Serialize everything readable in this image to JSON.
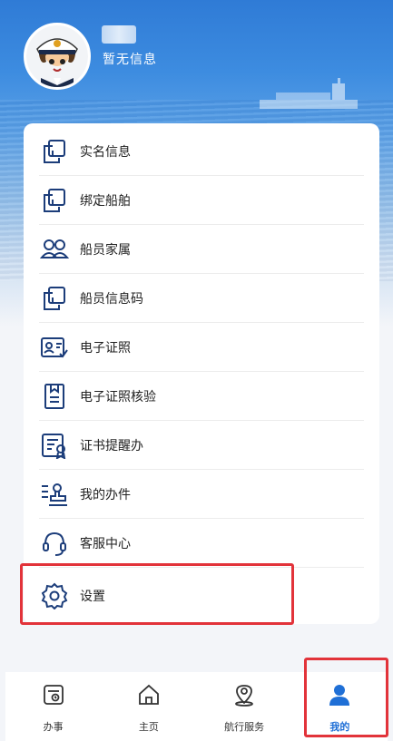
{
  "profile": {
    "info_text": "暂无信息"
  },
  "menu": {
    "items": [
      {
        "label": "实名信息",
        "icon": "id-card-icon"
      },
      {
        "label": "绑定船舶",
        "icon": "bind-ship-icon"
      },
      {
        "label": "船员家属",
        "icon": "family-icon"
      },
      {
        "label": "船员信息码",
        "icon": "qr-info-icon"
      },
      {
        "label": "电子证照",
        "icon": "certificate-icon"
      },
      {
        "label": "电子证照核验",
        "icon": "verify-icon"
      },
      {
        "label": "证书提醒办",
        "icon": "reminder-icon"
      },
      {
        "label": "我的办件",
        "icon": "my-cases-icon"
      },
      {
        "label": "客服中心",
        "icon": "headset-icon"
      },
      {
        "label": "设置",
        "icon": "gear-icon"
      }
    ]
  },
  "tabbar": {
    "tabs": [
      {
        "label": "办事",
        "icon": "service-icon"
      },
      {
        "label": "主页",
        "icon": "home-icon"
      },
      {
        "label": "航行服务",
        "icon": "location-icon"
      },
      {
        "label": "我的",
        "icon": "user-icon",
        "active": true
      }
    ]
  },
  "colors": {
    "accent": "#1f6fd6",
    "icon": "#1c3d7a",
    "highlight": "#e2333a"
  }
}
